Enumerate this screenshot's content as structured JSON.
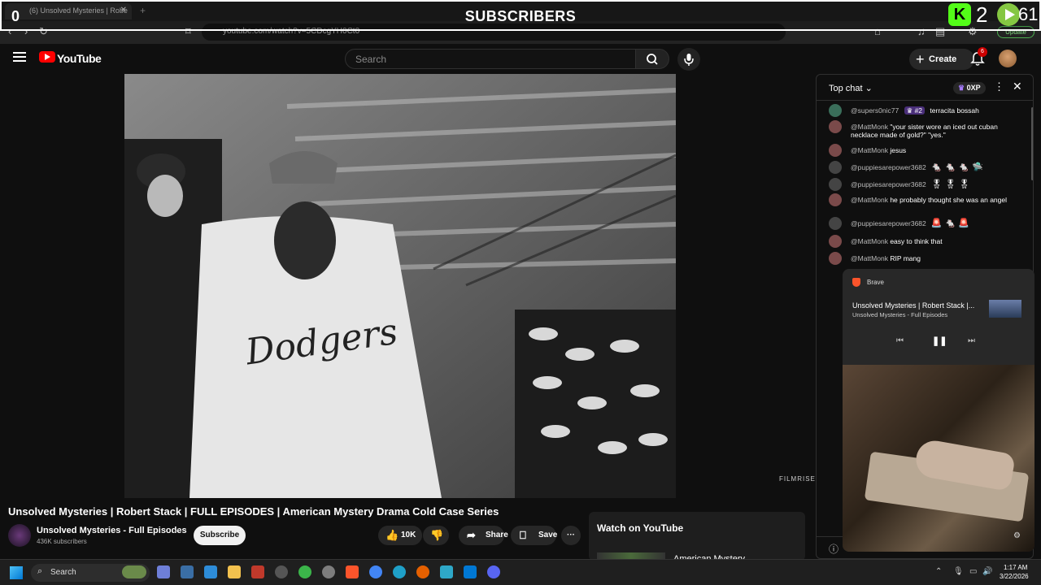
{
  "browser": {
    "tab_title": "(6) Unsolved Mysteries | Robe",
    "new_tab": "+",
    "url": "youtube.com/watch?v=5CDcgYH0Ct0",
    "update_label": "Update"
  },
  "stream_overlay": {
    "title": "SUBSCRIBERS",
    "left_count": "0",
    "kick_count": "2",
    "rumble_count": "61"
  },
  "youtube": {
    "logo": "YouTube",
    "search_placeholder": "Search",
    "create_label": "Create",
    "notification_count": "6"
  },
  "video": {
    "watermark": "FILMRISE",
    "title": "Unsolved Mysteries | Robert Stack | FULL EPISODES | American Mystery Drama Cold Case Series",
    "channel_name": "Unsolved Mysteries - Full Episodes",
    "channel_subs": "436K subscribers",
    "subscribe_label": "Subscribe",
    "like_count": "10K",
    "share_label": "Share",
    "save_label": "Save",
    "more_label": "···"
  },
  "watch_on": {
    "title": "Watch on YouTube",
    "next_title": "American Mystery"
  },
  "chat": {
    "header": "Top chat",
    "oxp_label": "0XP",
    "messages": [
      {
        "author": "@supers0nic77",
        "badge": "#2",
        "text": "terracita bossah",
        "color": "#3a6e5a"
      },
      {
        "author": "@MattMonk",
        "text": "\"your sister wore an iced out cuban necklace made of gold?\" \"yes.\"",
        "color": "#7a4a4a"
      },
      {
        "author": "@MattMonk",
        "text": "jesus",
        "color": "#7a4a4a"
      },
      {
        "author": "@puppiesarepower3682",
        "text": "",
        "emojis": "🐁 🐁 🐁 🛸",
        "color": "#444"
      },
      {
        "author": "@puppiesarepower3682",
        "text": "",
        "emojis": "🎖 🎖 🎖",
        "color": "#444"
      },
      {
        "author": "@MattMonk",
        "text": "he probably thought she was an angel",
        "color": "#7a4a4a"
      },
      {
        "author": "@puppiesarepower3682",
        "text": "",
        "emojis": "🚨 🐁 🚨",
        "color": "#444"
      },
      {
        "author": "@MattMonk",
        "text": "easy to think that",
        "color": "#7a4a4a"
      },
      {
        "author": "@MattMonk",
        "text": "RIP mang",
        "color": "#7a4a4a"
      }
    ]
  },
  "miniplayer": {
    "app": "Brave",
    "title": "Unsolved Mysteries | Robert Stack |...",
    "subtitle": "Unsolved Mysteries - Full Episodes"
  },
  "taskbar": {
    "search_label": "Search",
    "time": "1:17 AM",
    "date": "3/22/2026"
  }
}
